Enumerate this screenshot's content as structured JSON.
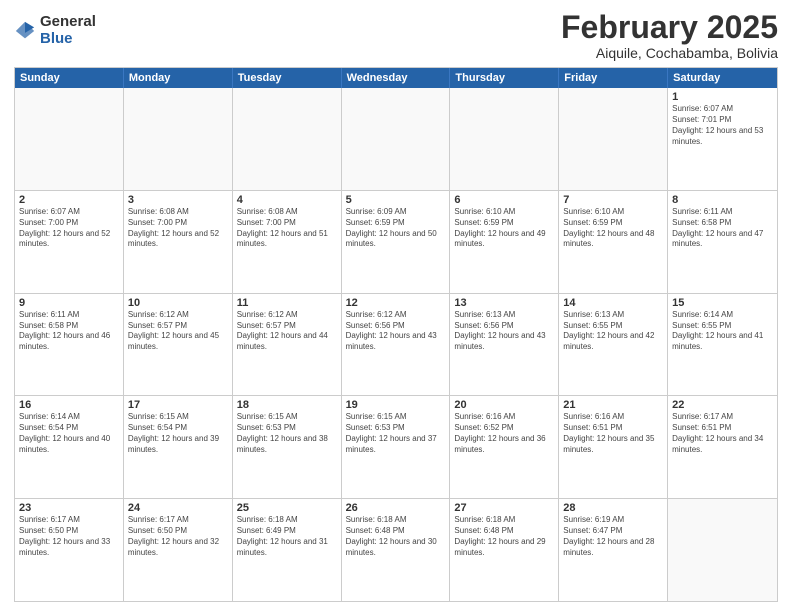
{
  "header": {
    "logo_general": "General",
    "logo_blue": "Blue",
    "title": "February 2025",
    "subtitle": "Aiquile, Cochabamba, Bolivia"
  },
  "calendar": {
    "days_of_week": [
      "Sunday",
      "Monday",
      "Tuesday",
      "Wednesday",
      "Thursday",
      "Friday",
      "Saturday"
    ],
    "weeks": [
      [
        {
          "day": "",
          "empty": true
        },
        {
          "day": "",
          "empty": true
        },
        {
          "day": "",
          "empty": true
        },
        {
          "day": "",
          "empty": true
        },
        {
          "day": "",
          "empty": true
        },
        {
          "day": "",
          "empty": true
        },
        {
          "day": "1",
          "sunrise": "6:07 AM",
          "sunset": "7:01 PM",
          "daylight": "12 hours and 53 minutes."
        }
      ],
      [
        {
          "day": "2",
          "sunrise": "6:07 AM",
          "sunset": "7:00 PM",
          "daylight": "12 hours and 52 minutes."
        },
        {
          "day": "3",
          "sunrise": "6:08 AM",
          "sunset": "7:00 PM",
          "daylight": "12 hours and 52 minutes."
        },
        {
          "day": "4",
          "sunrise": "6:08 AM",
          "sunset": "7:00 PM",
          "daylight": "12 hours and 51 minutes."
        },
        {
          "day": "5",
          "sunrise": "6:09 AM",
          "sunset": "6:59 PM",
          "daylight": "12 hours and 50 minutes."
        },
        {
          "day": "6",
          "sunrise": "6:10 AM",
          "sunset": "6:59 PM",
          "daylight": "12 hours and 49 minutes."
        },
        {
          "day": "7",
          "sunrise": "6:10 AM",
          "sunset": "6:59 PM",
          "daylight": "12 hours and 48 minutes."
        },
        {
          "day": "8",
          "sunrise": "6:11 AM",
          "sunset": "6:58 PM",
          "daylight": "12 hours and 47 minutes."
        }
      ],
      [
        {
          "day": "9",
          "sunrise": "6:11 AM",
          "sunset": "6:58 PM",
          "daylight": "12 hours and 46 minutes."
        },
        {
          "day": "10",
          "sunrise": "6:12 AM",
          "sunset": "6:57 PM",
          "daylight": "12 hours and 45 minutes."
        },
        {
          "day": "11",
          "sunrise": "6:12 AM",
          "sunset": "6:57 PM",
          "daylight": "12 hours and 44 minutes."
        },
        {
          "day": "12",
          "sunrise": "6:12 AM",
          "sunset": "6:56 PM",
          "daylight": "12 hours and 43 minutes."
        },
        {
          "day": "13",
          "sunrise": "6:13 AM",
          "sunset": "6:56 PM",
          "daylight": "12 hours and 43 minutes."
        },
        {
          "day": "14",
          "sunrise": "6:13 AM",
          "sunset": "6:55 PM",
          "daylight": "12 hours and 42 minutes."
        },
        {
          "day": "15",
          "sunrise": "6:14 AM",
          "sunset": "6:55 PM",
          "daylight": "12 hours and 41 minutes."
        }
      ],
      [
        {
          "day": "16",
          "sunrise": "6:14 AM",
          "sunset": "6:54 PM",
          "daylight": "12 hours and 40 minutes."
        },
        {
          "day": "17",
          "sunrise": "6:15 AM",
          "sunset": "6:54 PM",
          "daylight": "12 hours and 39 minutes."
        },
        {
          "day": "18",
          "sunrise": "6:15 AM",
          "sunset": "6:53 PM",
          "daylight": "12 hours and 38 minutes."
        },
        {
          "day": "19",
          "sunrise": "6:15 AM",
          "sunset": "6:53 PM",
          "daylight": "12 hours and 37 minutes."
        },
        {
          "day": "20",
          "sunrise": "6:16 AM",
          "sunset": "6:52 PM",
          "daylight": "12 hours and 36 minutes."
        },
        {
          "day": "21",
          "sunrise": "6:16 AM",
          "sunset": "6:51 PM",
          "daylight": "12 hours and 35 minutes."
        },
        {
          "day": "22",
          "sunrise": "6:17 AM",
          "sunset": "6:51 PM",
          "daylight": "12 hours and 34 minutes."
        }
      ],
      [
        {
          "day": "23",
          "sunrise": "6:17 AM",
          "sunset": "6:50 PM",
          "daylight": "12 hours and 33 minutes."
        },
        {
          "day": "24",
          "sunrise": "6:17 AM",
          "sunset": "6:50 PM",
          "daylight": "12 hours and 32 minutes."
        },
        {
          "day": "25",
          "sunrise": "6:18 AM",
          "sunset": "6:49 PM",
          "daylight": "12 hours and 31 minutes."
        },
        {
          "day": "26",
          "sunrise": "6:18 AM",
          "sunset": "6:48 PM",
          "daylight": "12 hours and 30 minutes."
        },
        {
          "day": "27",
          "sunrise": "6:18 AM",
          "sunset": "6:48 PM",
          "daylight": "12 hours and 29 minutes."
        },
        {
          "day": "28",
          "sunrise": "6:19 AM",
          "sunset": "6:47 PM",
          "daylight": "12 hours and 28 minutes."
        },
        {
          "day": "",
          "empty": true
        }
      ]
    ]
  }
}
